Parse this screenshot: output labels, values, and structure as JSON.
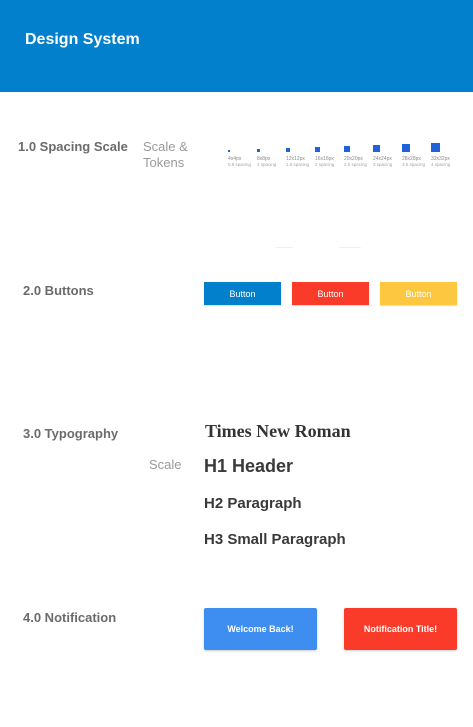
{
  "header": {
    "title": "Design System",
    "background": "#0280cc"
  },
  "sections": {
    "spacing": {
      "title": "1.0 Spacing Scale",
      "subtitle": "Scale & Tokens"
    },
    "buttons": {
      "title": "2.0 Buttons"
    },
    "typography": {
      "title": "3.0 Typography",
      "subtitle": "Scale"
    },
    "notification": {
      "title": "4.0 Notification"
    }
  },
  "spacing_scale": [
    {
      "label": "4x4px",
      "sub": "0.5 spacing"
    },
    {
      "label": "8x8px",
      "sub": "1 spacing"
    },
    {
      "label": "12x12px",
      "sub": "1.5 spacing"
    },
    {
      "label": "16x16px",
      "sub": "2 spacing"
    },
    {
      "label": "20x20px",
      "sub": "2.5 spacing"
    },
    {
      "label": "24x24px",
      "sub": "3 spacing"
    },
    {
      "label": "28x28px",
      "sub": "3.5 spacing"
    },
    {
      "label": "32x32px",
      "sub": "4 spacing"
    }
  ],
  "buttons": {
    "blue": {
      "label": "Button",
      "color": "#0280cc"
    },
    "red": {
      "label": "Button",
      "color": "#fb3b2a"
    },
    "yellow": {
      "label": "Button",
      "color": "#fec740"
    }
  },
  "typography": {
    "family": "Times New Roman",
    "h1": "H1 Header",
    "h2": "H2 Paragraph",
    "h3": "H3 Small Paragraph"
  },
  "notifications": {
    "welcome": {
      "label": "Welcome Back!",
      "color": "#3d8ef0"
    },
    "title": {
      "label": "Notification Title!",
      "color": "#fb3b2a"
    }
  }
}
